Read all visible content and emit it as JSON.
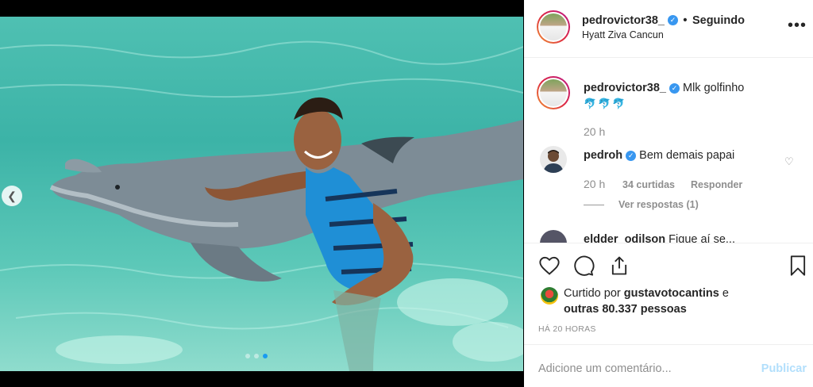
{
  "post": {
    "dots_count": 3,
    "active_dot": 2
  },
  "header": {
    "username": "pedrovictor38_",
    "separator": "•",
    "follow_status": "Seguindo",
    "location": "Hyatt Ziva Cancun",
    "more_icon": "more-horizontal-icon"
  },
  "caption": {
    "username": "pedrovictor38_",
    "text": "Mlk golfinho",
    "emojis": [
      "🐬",
      "🐬",
      "🐬"
    ],
    "time": "20 h"
  },
  "comments": [
    {
      "username": "pedroh",
      "text": "Bem demais papai",
      "time": "20 h",
      "likes": "34 curtidas",
      "reply_label": "Responder",
      "view_replies": "Ver respostas (1)"
    },
    {
      "username": "eldder_odilson",
      "text": "Fique aí se..."
    }
  ],
  "actions": {
    "liked_by_prefix": "Curtido por",
    "liked_by_user": "gustavotocantins",
    "liked_by_suffix": "e",
    "others": "outras 80.337 pessoas",
    "posted_ago": "HÁ 20 HORAS"
  },
  "add_comment": {
    "placeholder": "Adicione um comentário...",
    "publish_label": "Publicar"
  },
  "colors": {
    "verified": "#3897f0",
    "publish": "#b2dffc",
    "active_dot": "#1a9bf0"
  }
}
